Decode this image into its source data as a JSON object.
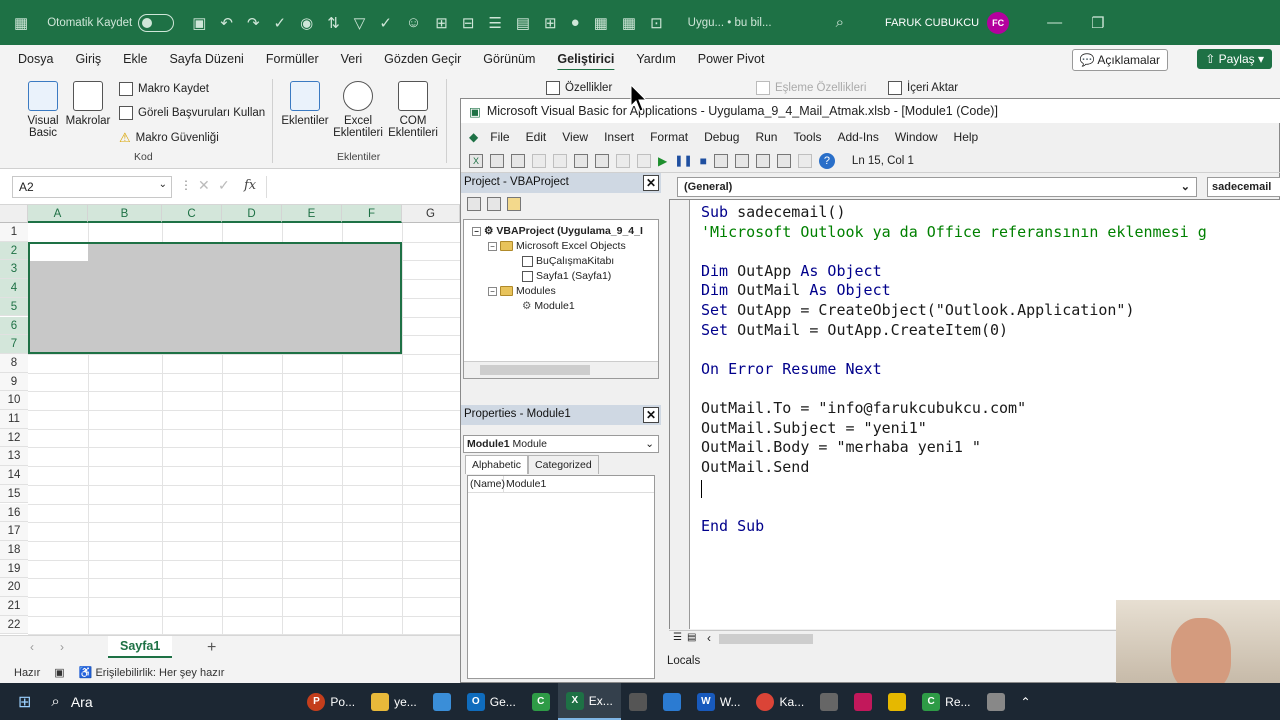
{
  "excel": {
    "autosave_label": "Otomatik Kaydet",
    "window_title": "Uygu... • bu bil...",
    "user_name": "FARUK CUBUKCU",
    "user_initials": "FC",
    "tabs": [
      "Dosya",
      "Giriş",
      "Ekle",
      "Sayfa Düzeni",
      "Formüller",
      "Veri",
      "Gözden Geçir",
      "Görünüm",
      "Geliştirici",
      "Yardım",
      "Power Pivot"
    ],
    "active_tab": "Geliştirici",
    "comments_button": "Açıklamalar",
    "share_button": "Paylaş",
    "ribbon": {
      "visual_basic": "Visual Basic",
      "macros": "Makrolar",
      "record_macro": "Makro Kaydet",
      "relative_refs": "Göreli Başvuruları Kullan",
      "macro_security": "Makro Güvenliği",
      "group_code": "Kod",
      "addins": "Eklentiler",
      "excel_addins": "Excel Eklentileri",
      "com_addins": "COM Eklentileri",
      "group_addins": "Eklentiler",
      "properties": "Özellikler",
      "map_properties": "Eşleme Özellikleri",
      "import": "İçeri Aktar"
    },
    "name_box": "A2",
    "fx_label": "fx",
    "columns": [
      "A",
      "B",
      "C",
      "D",
      "E",
      "F",
      "G"
    ],
    "rows": [
      "1",
      "2",
      "3",
      "4",
      "5",
      "6",
      "7",
      "8",
      "9",
      "10",
      "11",
      "12",
      "13",
      "14",
      "15",
      "16",
      "17",
      "18",
      "19",
      "20",
      "21",
      "22"
    ],
    "sheet_tab": "Sayfa1",
    "status_ready": "Hazır",
    "status_accessibility": "Erişilebilirlik: Her şey hazır"
  },
  "vba": {
    "title": "Microsoft Visual Basic for Applications - Uygulama_9_4_Mail_Atmak.xlsb - [Module1 (Code)]",
    "menu": [
      "File",
      "Edit",
      "View",
      "Insert",
      "Format",
      "Debug",
      "Run",
      "Tools",
      "Add-Ins",
      "Window",
      "Help"
    ],
    "position": "Ln 15, Col 1",
    "project_title": "Project - VBAProject",
    "tree": {
      "root": "VBAProject (Uygulama_9_4_I",
      "excel_objects": "Microsoft Excel Objects",
      "workbook": "BuÇalışmaKitabı",
      "sheet": "Sayfa1 (Sayfa1)",
      "modules": "Modules",
      "module1": "Module1"
    },
    "properties_title": "Properties - Module1",
    "properties_object": "Module1",
    "properties_type": "Module",
    "prop_tabs": [
      "Alphabetic",
      "Categorized"
    ],
    "prop_name_key": "(Name)",
    "prop_name_value": "Module1",
    "combo_general": "(General)",
    "combo_proc": "sadecemail",
    "code": {
      "l1_kw": "Sub",
      "l1_rest": " sadecemail()",
      "l2_comment": "'Microsoft Outlook ya da Office referansının eklenmesi g",
      "l4_kw1": "Dim",
      "l4_mid": " OutApp ",
      "l4_kw2": "As Object",
      "l5_kw1": "Dim",
      "l5_mid": " OutMail ",
      "l5_kw2": "As Object",
      "l6_kw": "Set",
      "l6_rest": " OutApp = CreateObject(\"Outlook.Application\")",
      "l7_kw": "Set",
      "l7_rest": " OutMail = OutApp.CreateItem(0)",
      "l9": "On Error Resume Next",
      "l11": "OutMail.To = \"info@farukcubukcu.com\"",
      "l12": "OutMail.Subject = \"yeni1\"",
      "l13": "OutMail.Body = \"merhaba yeni1 \"",
      "l14": "OutMail.Send",
      "l17": "End Sub"
    },
    "locals_label": "Locals"
  },
  "taskbar": {
    "search": "Ara",
    "items": [
      "Po...",
      "ye...",
      "Ge...",
      "Ex...",
      "W...",
      "Ka...",
      "Re..."
    ]
  }
}
